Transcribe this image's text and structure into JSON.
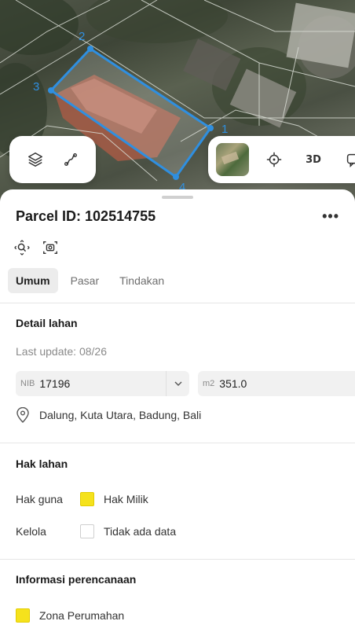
{
  "map": {
    "vertex_labels": [
      "2",
      "3",
      "1",
      "4"
    ],
    "controls_left": [
      {
        "name": "layers-icon"
      },
      {
        "name": "measure-icon"
      }
    ],
    "controls_right": {
      "label_3d": "3D"
    }
  },
  "sheet": {
    "title": "Parcel ID: 102514755",
    "more_label": "•••",
    "tabs": [
      {
        "label": "Umum",
        "active": true
      },
      {
        "label": "Pasar",
        "active": false
      },
      {
        "label": "Tindakan",
        "active": false
      }
    ]
  },
  "detail": {
    "heading": "Detail lahan",
    "last_update": "Last update: 08/26",
    "nib_prefix": "NIB",
    "nib_value": "17196",
    "area_prefix": "m2",
    "area_value": "351.0",
    "location": "Dalung, Kuta Utara, Badung, Bali"
  },
  "hak": {
    "heading": "Hak lahan",
    "rows": [
      {
        "key": "Hak guna",
        "value": "Hak Milik",
        "swatch": "yellow"
      },
      {
        "key": "Kelola",
        "value": "Tidak ada data",
        "swatch": "empty"
      }
    ]
  },
  "planning": {
    "heading": "Informasi perencanaan",
    "zone": "Zona Perumahan"
  },
  "colors": {
    "parcel_outline": "#2f8fe0",
    "yellow_swatch": "#f5e21c"
  }
}
